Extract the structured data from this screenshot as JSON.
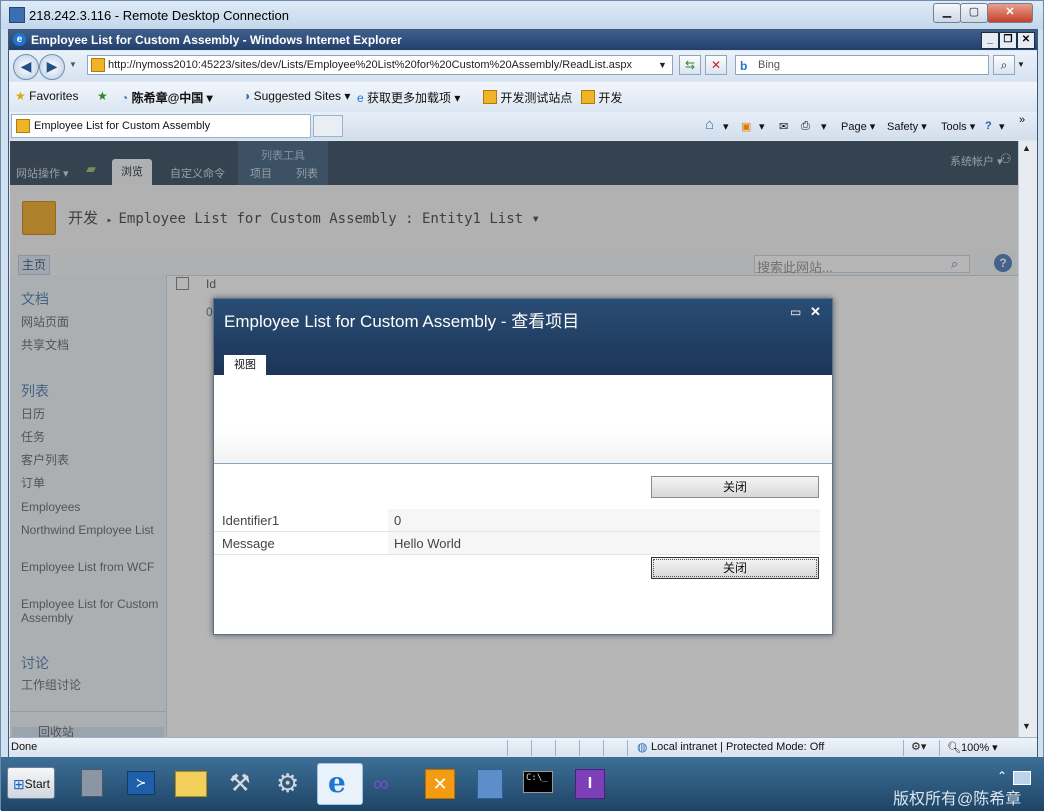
{
  "rdp": {
    "title": "218.242.3.116 - Remote Desktop Connection",
    "min": "▁",
    "max": "▢",
    "close": "✕"
  },
  "ie": {
    "title": "Employee List for Custom Assembly - Windows Internet Explorer",
    "min": "_",
    "max": "❐",
    "close": "✕",
    "address": "http://nymoss2010:45223/sites/dev/Lists/Employee%20List%20for%20Custom%20Assembly/ReadList.aspx",
    "search_value": "Bing",
    "favorites": {
      "label": "Favorites",
      "items": [
        "陈希章@中国",
        "Suggested Sites",
        "获取更多加载项",
        "开发测试站点",
        "开发"
      ]
    },
    "tab_label": "Employee List for Custom Assembly",
    "commands": {
      "page": "Page",
      "safety": "Safety",
      "tools": "Tools"
    }
  },
  "sharepoint": {
    "ribbon": {
      "site_actions": "网站操作",
      "browse": "浏览",
      "custom_commands": "自定义命令",
      "tools_group": "列表工具",
      "items": "项目",
      "list": "列表",
      "account": "系统帐户"
    },
    "header": {
      "site": "开发",
      "title": "Employee List for Custom Assembly",
      "view": "Entity1 List"
    },
    "topnav_home": "主页",
    "search_placeholder": "搜索此网站...",
    "quicklaunch": {
      "docs_heading": "文档",
      "docs_items": [
        "网站页面",
        "共享文档"
      ],
      "lists_heading": "列表",
      "list_items": [
        "日历",
        "任务",
        "客户列表",
        "订单",
        "Employees",
        "Northwind Employee List",
        "Employee List from WCF",
        "Employee List for Custom Assembly"
      ],
      "discuss_heading": "讨论",
      "discuss_items": [
        "工作组讨论"
      ],
      "recycle": "回收站"
    },
    "main": {
      "col_header": "Id",
      "cell_value": "0"
    }
  },
  "dialog": {
    "title": "Employee List for Custom Assembly - 查看项目",
    "tab": "视图",
    "close_button": "关闭",
    "fields": [
      {
        "label": "Identifier1",
        "value": "0"
      },
      {
        "label": "Message",
        "value": "Hello World"
      }
    ]
  },
  "status": {
    "text": "Done",
    "zone": "Local intranet | Protected Mode: Off",
    "zoom": "100%"
  },
  "taskbar": {
    "start": "Start",
    "copyright": "版权所有@陈希章"
  }
}
